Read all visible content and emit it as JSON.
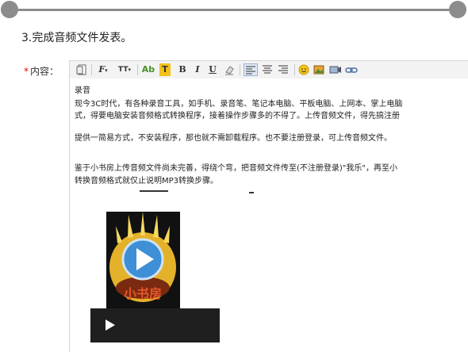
{
  "step_title": "3.完成音频文件发表。",
  "field": {
    "required_mark": "*",
    "label": "内容："
  },
  "toolbar": {
    "font_family_label": "F",
    "font_size_label": "TT",
    "font_color_label": "Ab",
    "highlight_label": "T",
    "bold_label": "B",
    "italic_label": "I",
    "underline_label": "U"
  },
  "content": {
    "line1": "录音",
    "line2": "现今3C时代，有各种录音工具，如手机、录音笔、笔记本电脑、平板电脑、上网本、掌上电脑",
    "line3": "式，得要电脑安装音频格式转换程序，接着操作步骤多的不得了。上传音频文件，得先搞注册",
    "line4": "提供一简易方式，不安装程序，那也就不需卸载程序。也不要注册登录，可上传音频文件。",
    "line5": "鉴于小书房上传音频文件尚未完善，得绕个弯，把音频文件传至(不注册登录)\"我乐\"，再至小",
    "line6": "转换音频格式就仅止说明MP3转换步骤。"
  },
  "video": {
    "logo_text": "小书房"
  },
  "colors": {
    "rule": "#8c8c8c",
    "required": "#e00000",
    "play_blue": "#3f8fd6",
    "video_bg": "#111111"
  }
}
